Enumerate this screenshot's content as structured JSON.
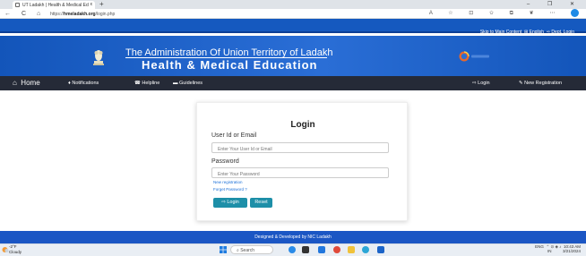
{
  "browser": {
    "tab_title": "UT Ladakh | Health & Medical Ed",
    "tab_close": "x",
    "new_tab": "+",
    "window_controls": "– ❐ ✕",
    "nav_icons": "← C ⌂",
    "url_prefix": "https://",
    "url_host": "hmeladakh.org",
    "url_path": "/login.php",
    "toolbar_icons": "A ☆ ⊡ ✩ ⧉ ❦ ⋯"
  },
  "topbar": {
    "skip_link": "Skip to Main Content",
    "english": "English",
    "dept_login": "Dept. Login"
  },
  "header": {
    "title_line1": "The Administration Of Union Territory of Ladakh",
    "title_line2": "Health & Medical Education"
  },
  "nav": {
    "home": "Home",
    "notifications": "Notifications",
    "helpline": "Helpline",
    "guidelines": "Guidelines",
    "login": "Login",
    "new_registration": "New Registration"
  },
  "login": {
    "title": "Login",
    "user_label": "User Id or Email",
    "user_placeholder": "Enter Your User Id or Email",
    "password_label": "Password",
    "password_placeholder": "Enter Your Password",
    "new_registration_link": "New registration",
    "forgot_password_link": "Forget Password ?",
    "login_button": "Login",
    "reset_button": "Reset"
  },
  "footer": {
    "text": "Designed & Developed by NIC Ladakh"
  },
  "taskbar": {
    "weather_temp": "-2°F",
    "weather_desc": "Cloudy",
    "search_placeholder": "Search",
    "language": "ENG",
    "region": "IN",
    "time": "10:43 AM",
    "date": "3/21/2024"
  },
  "colors": {
    "header_blue": "#1559bf",
    "nav_dark": "#252a37",
    "button_teal": "#1d8fa8",
    "footer_blue": "#1b56c4"
  }
}
